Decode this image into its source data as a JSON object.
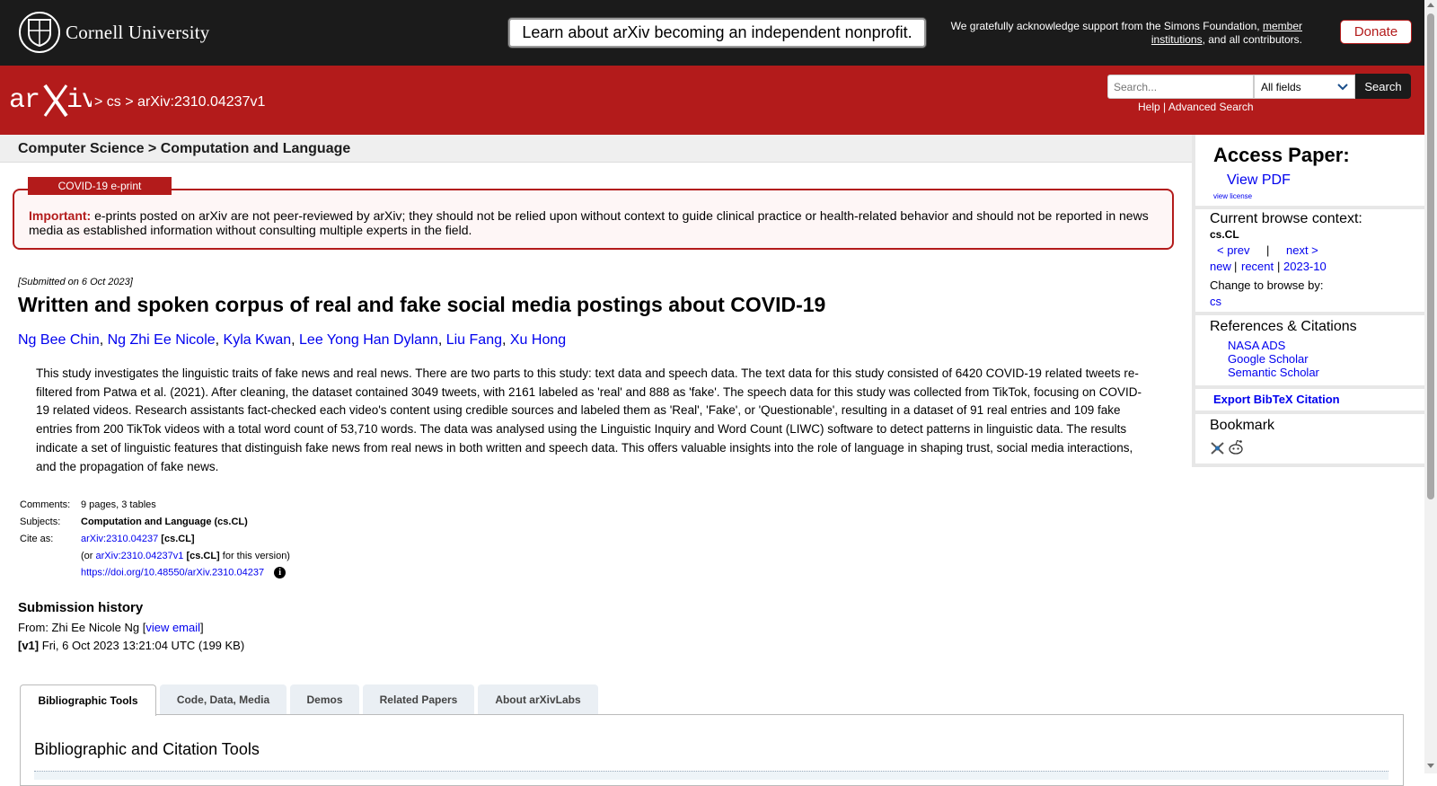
{
  "top": {
    "institution": "Cornell University",
    "notice_button": "Learn about arXiv becoming an independent nonprofit.",
    "support_prefix": "We gratefully acknowledge support from the Simons Foundation,",
    "support_link": "member institutions",
    "support_suffix": ", and all contributors.",
    "donate": "Donate"
  },
  "header": {
    "breadcrumb_sep1": ">",
    "breadcrumb_cs": "cs",
    "breadcrumb_sep2": ">",
    "breadcrumb_id": "arXiv:2310.04237v1",
    "search_placeholder": "Search...",
    "search_field": "All fields",
    "search_button": "Search",
    "help": "Help",
    "help_sep": "|",
    "advanced": "Advanced Search"
  },
  "subject_header": "Computer Science > Computation and Language",
  "covid": {
    "tab": "COVID-19 e-print",
    "important_label": "Important:",
    "important_text": "e-prints posted on arXiv are not peer-reviewed by arXiv; they should not be relied upon without context to guide clinical practice or health-related behavior and should not be reported in news media as established information without consulting multiple experts in the field."
  },
  "paper": {
    "submitted": "[Submitted on 6 Oct 2023]",
    "title": "Written and spoken corpus of real and fake social media postings about COVID-19",
    "authors": [
      "Ng Bee Chin",
      "Ng Zhi Ee Nicole",
      "Kyla Kwan",
      "Lee Yong Han Dylann",
      "Liu Fang",
      "Xu Hong"
    ],
    "abstract": "This study investigates the linguistic traits of fake news and real news. There are two parts to this study: text data and speech data. The text data for this study consisted of 6420 COVID-19 related tweets re-filtered from Patwa et al. (2021). After cleaning, the dataset contained 3049 tweets, with 2161 labeled as 'real' and 888 as 'fake'. The speech data for this study was collected from TikTok, focusing on COVID-19 related videos. Research assistants fact-checked each video's content using credible sources and labeled them as 'Real', 'Fake', or 'Questionable', resulting in a dataset of 91 real entries and 109 fake entries from 200 TikTok videos with a total word count of 53,710 words. The data was analysed using the Linguistic Inquiry and Word Count (LIWC) software to detect patterns in linguistic data. The results indicate a set of linguistic features that distinguish fake news from real news in both written and speech data. This offers valuable insights into the role of language in shaping trust, social media interactions, and the propagation of fake news."
  },
  "metadata": {
    "comments_label": "Comments:",
    "comments": "9 pages, 3 tables",
    "subjects_label": "Subjects:",
    "subjects": "Computation and Language (cs.CL)",
    "cite_label": "Cite as:",
    "cite_id": "arXiv:2310.04237",
    "cite_tag": "[cs.CL]",
    "version_prefix": "(or",
    "version_id": "arXiv:2310.04237v1",
    "version_tag": "[cs.CL]",
    "version_suffix": "for this version)",
    "doi": "https://doi.org/10.48550/arXiv.2310.04237",
    "info_glyph": "i"
  },
  "history": {
    "title": "Submission history",
    "from_prefix": "From: Zhi Ee Nicole Ng [",
    "from_link": "view email",
    "from_suffix": "]",
    "v1_label": "[v1]",
    "v1_text": "Fri, 6 Oct 2023 13:21:04 UTC (199 KB)"
  },
  "tabs": [
    {
      "label": "Bibliographic Tools",
      "active": true
    },
    {
      "label": "Code, Data, Media",
      "active": false
    },
    {
      "label": "Demos",
      "active": false
    },
    {
      "label": "Related Papers",
      "active": false
    },
    {
      "label": "About arXivLabs",
      "active": false
    }
  ],
  "tabpanel_title": "Bibliographic and Citation Tools",
  "sidebar": {
    "access_title": "Access Paper:",
    "view_pdf": "View PDF",
    "view_license": "view license",
    "browse_title": "Current browse context:",
    "browse_context": "cs.CL",
    "prev": "< prev",
    "pipe": "|",
    "next": "next >",
    "new": "new",
    "recent": "recent",
    "month": "2023-10",
    "change_browse": "Change to browse by:",
    "browse_cs": "cs",
    "refs_title": "References & Citations",
    "nasa": "NASA ADS",
    "google": "Google Scholar",
    "semantic": "Semantic Scholar",
    "export": "Export BibTeX Citation",
    "bookmark_title": "Bookmark"
  },
  "colors": {
    "arxiv_red": "#b31b1b",
    "topbar": "#1b1b1b",
    "link": "#0000ee"
  }
}
